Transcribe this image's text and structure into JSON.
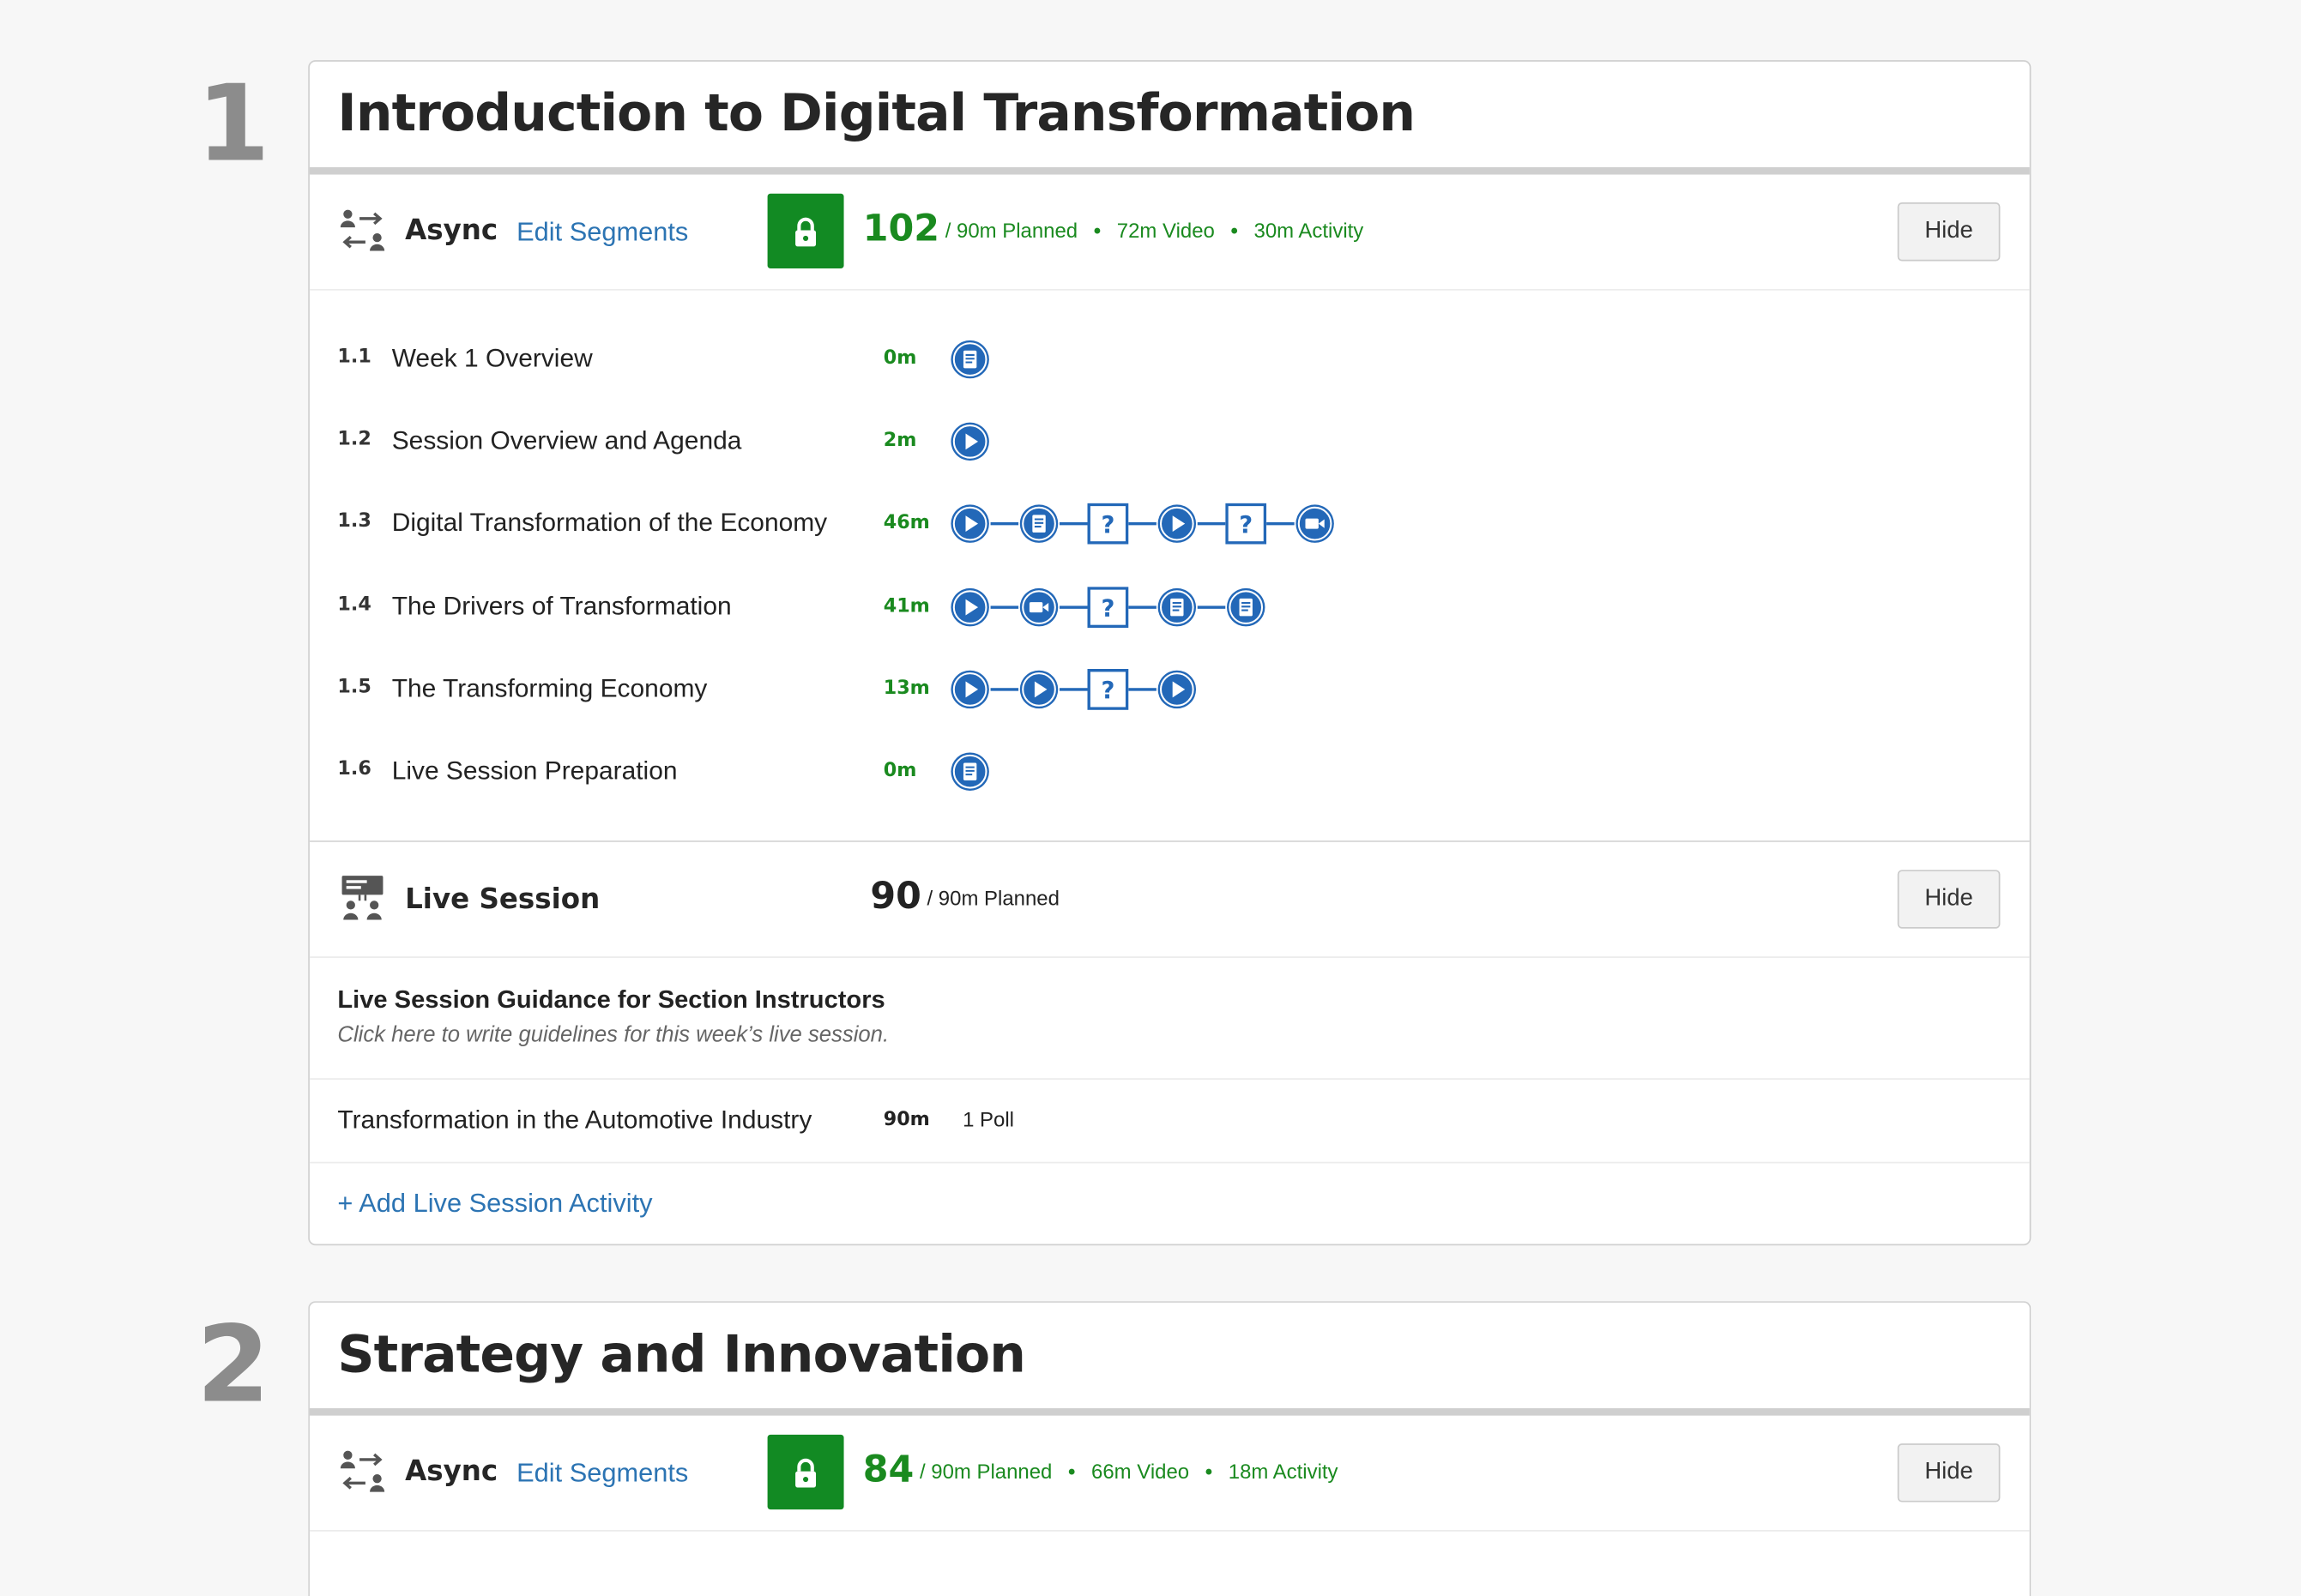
{
  "weeks": [
    {
      "number": "1",
      "title": "Introduction to Digital Transformation",
      "async": {
        "label": "Async",
        "edit_label": "Edit Segments",
        "total": "102",
        "planned": "/ 90m Planned",
        "video": "72m Video",
        "activity": "30m Activity",
        "hide_label": "Hide",
        "items": [
          {
            "num": "1.1",
            "title": "Week 1 Overview",
            "duration": "0m",
            "nodes": [
              "reading-icon"
            ]
          },
          {
            "num": "1.2",
            "title": "Session Overview and Agenda",
            "duration": "2m",
            "nodes": [
              "play-icon"
            ]
          },
          {
            "num": "1.3",
            "title": "Digital Transformation of the Economy",
            "duration": "46m",
            "nodes": [
              "play-icon",
              "reading-icon",
              "quiz-icon",
              "play-icon",
              "quiz-icon",
              "video-camera-icon"
            ]
          },
          {
            "num": "1.4",
            "title": "The Drivers of Transformation",
            "duration": "41m",
            "nodes": [
              "play-icon",
              "video-camera-icon",
              "quiz-icon",
              "reading-icon",
              "reading-icon"
            ]
          },
          {
            "num": "1.5",
            "title": "The Transforming Economy",
            "duration": "13m",
            "nodes": [
              "play-icon",
              "play-icon",
              "quiz-icon",
              "play-icon"
            ]
          },
          {
            "num": "1.6",
            "title": "Live Session Preparation",
            "duration": "0m",
            "nodes": [
              "reading-icon"
            ]
          }
        ]
      },
      "live": {
        "label": "Live Session",
        "total": "90",
        "planned": "/ 90m Planned",
        "hide_label": "Hide",
        "guidance_title": "Live Session Guidance for Section Instructors",
        "guidance_hint": "Click here to write guidelines for this week’s live session.",
        "activity_title": "Transformation in the Automotive Industry",
        "activity_duration": "90m",
        "activity_poll": "1 Poll",
        "add_label": "+ Add Live Session Activity"
      }
    },
    {
      "number": "2",
      "title": "Strategy and Innovation",
      "async": {
        "label": "Async",
        "edit_label": "Edit Segments",
        "total": "84",
        "planned": "/ 90m Planned",
        "video": "66m Video",
        "activity": "18m Activity",
        "hide_label": "Hide"
      }
    }
  ],
  "colors": {
    "accent_blue": "#2368b8",
    "status_green": "#128a23",
    "number_gray": "#8c8c8c"
  }
}
